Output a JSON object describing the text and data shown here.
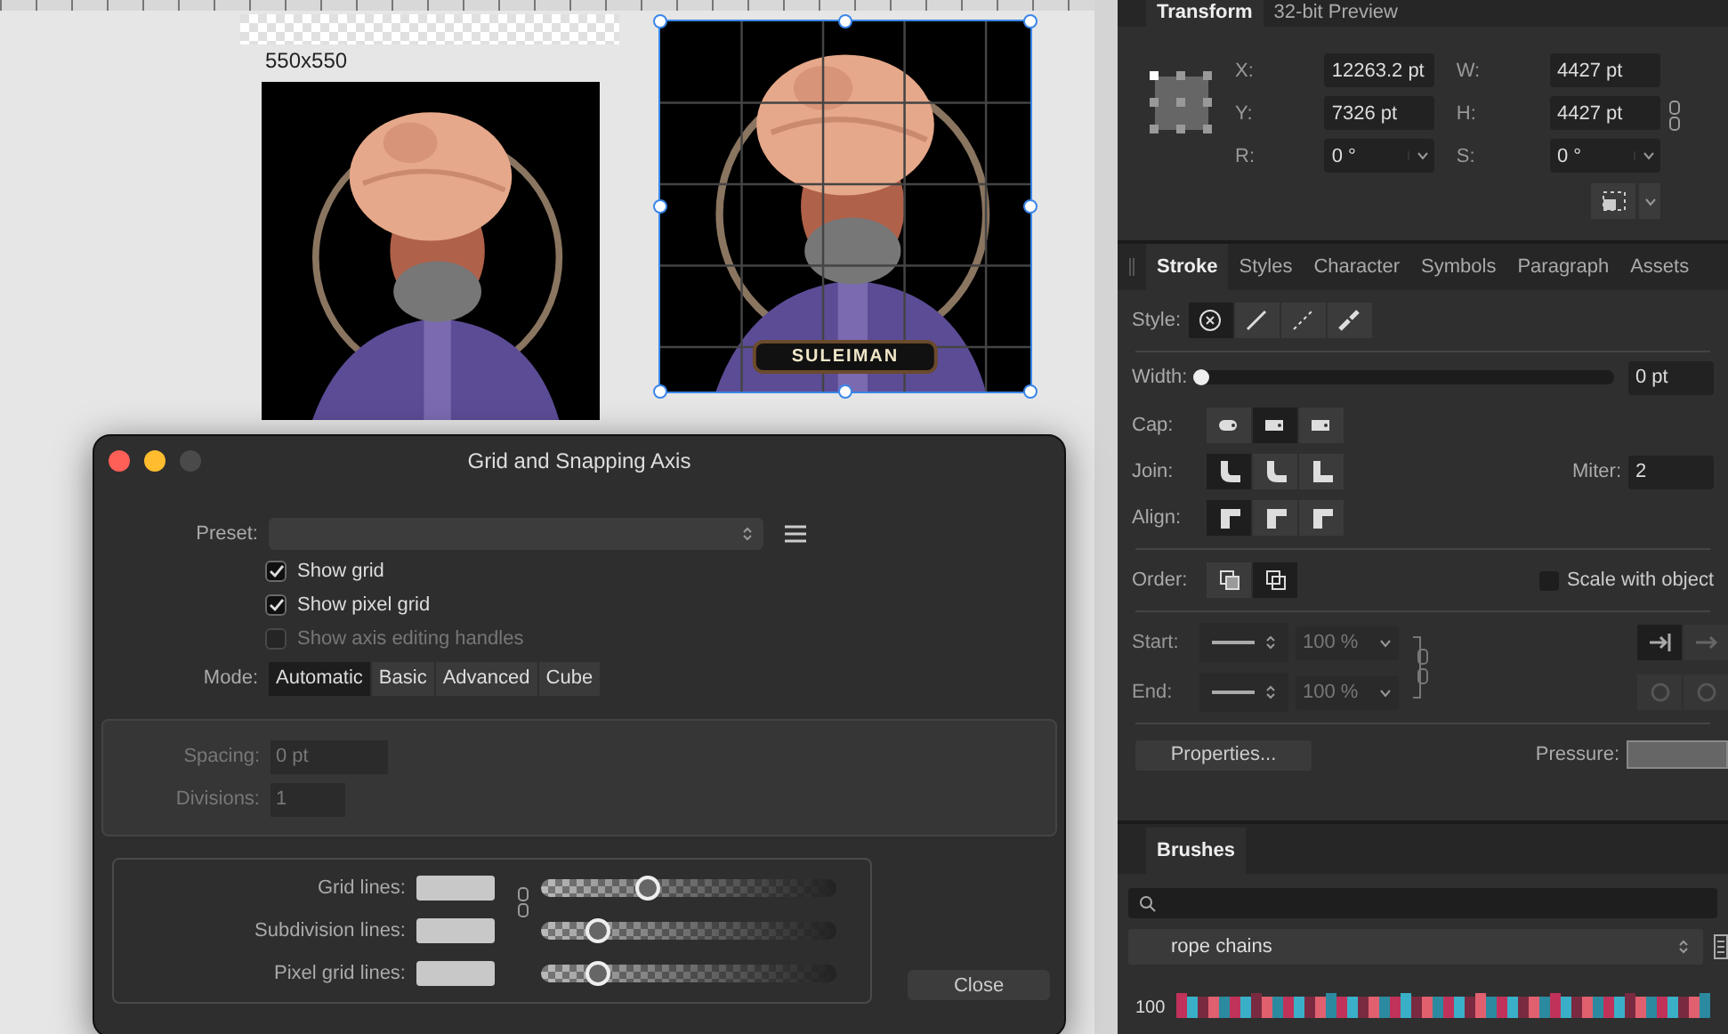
{
  "canvas": {
    "size_label": "550x550",
    "artboards": [
      {
        "kind": "picture",
        "selected": false
      },
      {
        "kind": "picture",
        "selected": true,
        "caption": "SULEIMAN"
      }
    ]
  },
  "dialog": {
    "title": "Grid and Snapping Axis",
    "preset_label": "Preset:",
    "checkboxes": [
      {
        "label": "Show grid",
        "checked": true,
        "disabled": false
      },
      {
        "label": "Show pixel grid",
        "checked": true,
        "disabled": false
      },
      {
        "label": "Show axis editing handles",
        "checked": false,
        "disabled": true
      }
    ],
    "mode_label": "Mode:",
    "modes": [
      {
        "label": "Automatic",
        "selected": true
      },
      {
        "label": "Basic",
        "selected": false
      },
      {
        "label": "Advanced",
        "selected": false
      },
      {
        "label": "Cube",
        "selected": false
      }
    ],
    "fields": [
      {
        "label": "Spacing:",
        "value": "0 pt"
      },
      {
        "label": "Divisions:",
        "value": "1"
      }
    ],
    "lines": [
      {
        "label": "Grid lines:",
        "level": 0.36
      },
      {
        "label": "Subdivision lines:",
        "level": 0.19
      },
      {
        "label": "Pixel grid lines:",
        "level": 0.19
      }
    ],
    "close": "Close"
  },
  "transform": {
    "tabs": [
      {
        "label": "Transform",
        "selected": true
      },
      {
        "label": "32-bit Preview",
        "selected": false
      }
    ],
    "fields": [
      {
        "label": "X:",
        "value": "12263.2 pt",
        "dropdown": false
      },
      {
        "label": "W:",
        "value": "4427 pt",
        "dropdown": false
      },
      {
        "label": "Y:",
        "value": "7326 pt",
        "dropdown": false
      },
      {
        "label": "H:",
        "value": "4427 pt",
        "dropdown": false
      },
      {
        "label": "R:",
        "value": "0 °",
        "dropdown": true
      },
      {
        "label": "S:",
        "value": "0 °",
        "dropdown": true
      }
    ]
  },
  "stroke": {
    "tabs": [
      {
        "label": "Stroke",
        "selected": true
      },
      {
        "label": "Styles",
        "selected": false
      },
      {
        "label": "Character",
        "selected": false
      },
      {
        "label": "Symbols",
        "selected": false
      },
      {
        "label": "Paragraph",
        "selected": false
      },
      {
        "label": "Assets",
        "selected": false
      }
    ],
    "style": {
      "label": "Style:",
      "options": [
        {
          "selected": true
        },
        {
          "selected": false
        },
        {
          "selected": false
        },
        {
          "selected": false
        }
      ]
    },
    "width": {
      "label": "Width:",
      "level": 0,
      "value": "0 pt"
    },
    "cap": {
      "label": "Cap:",
      "options": [
        {
          "selected": false
        },
        {
          "selected": true
        },
        {
          "selected": false
        }
      ]
    },
    "join": {
      "label": "Join:",
      "options": [
        {
          "selected": true
        },
        {
          "selected": false
        },
        {
          "selected": false
        }
      ]
    },
    "miter": {
      "label": "Miter:",
      "value": "2"
    },
    "align": {
      "label": "Align:",
      "options": [
        {
          "selected": true
        },
        {
          "selected": false
        },
        {
          "selected": false
        }
      ]
    },
    "order": {
      "label": "Order:",
      "options": [
        {
          "selected": false
        },
        {
          "selected": true
        }
      ]
    },
    "scale_with_object": {
      "label": "Scale with object",
      "checked": false
    },
    "arrows": [
      {
        "label": "Start:",
        "value": "100 %"
      },
      {
        "label": "End:",
        "value": "100 %"
      }
    ],
    "properties": "Properties...",
    "pressure_label": "Pressure:"
  },
  "brushes": {
    "tabs": [
      {
        "label": "Brushes",
        "selected": true
      }
    ],
    "category": "rope chains",
    "items": [
      {
        "size": "100"
      }
    ]
  }
}
